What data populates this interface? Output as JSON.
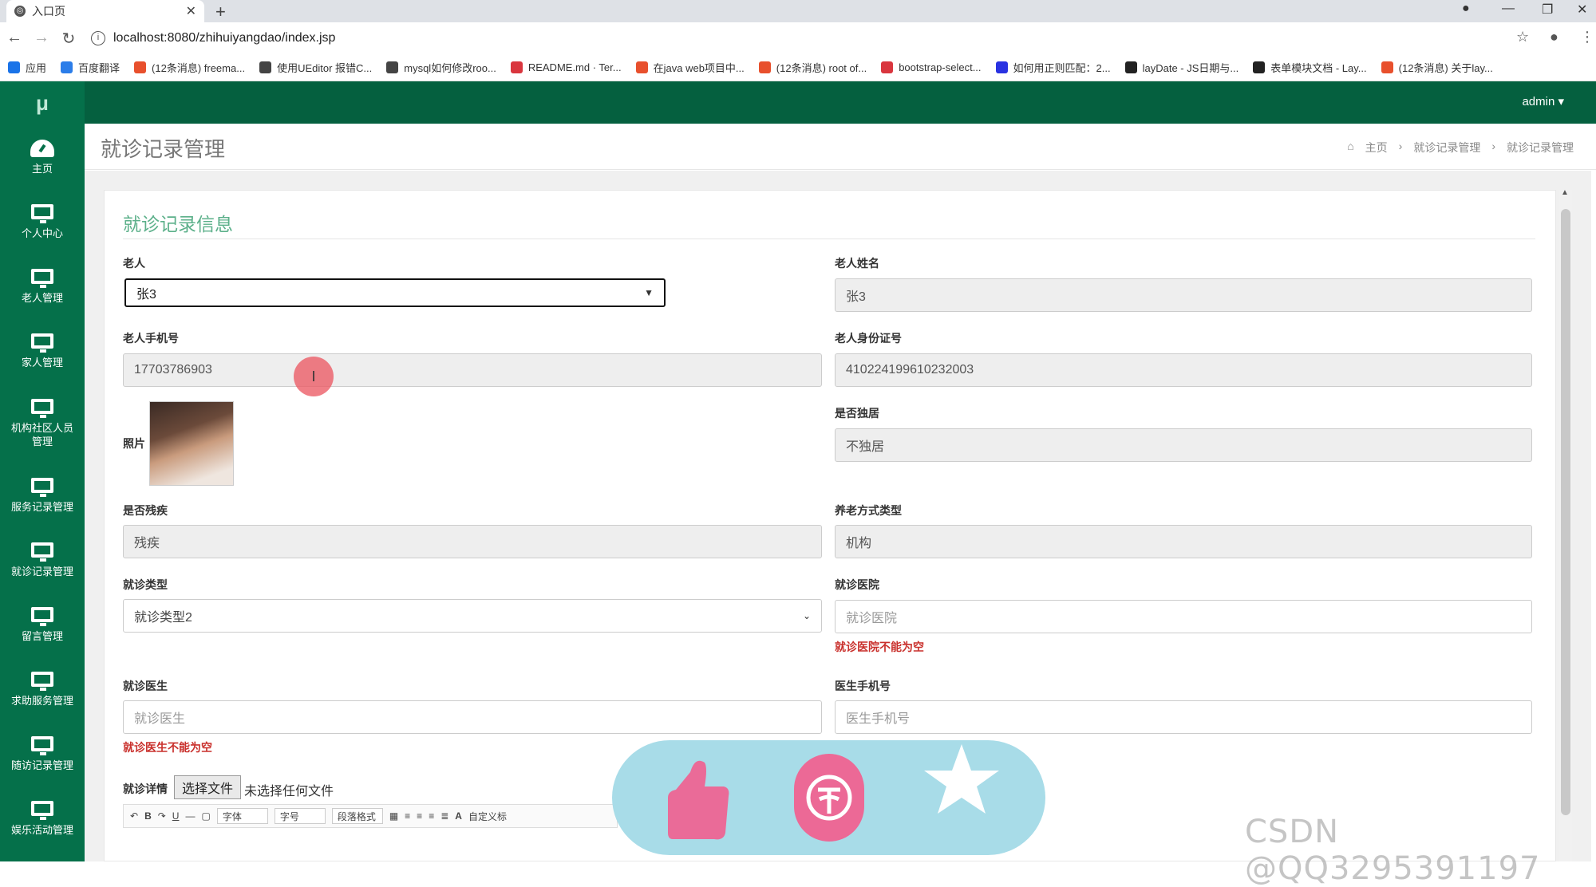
{
  "browser": {
    "tab_title": "入口页",
    "url": "localhost:8080/zhihuiyangdao/index.jsp",
    "bookmarks": [
      {
        "label": "应用",
        "color": "#1a73e8"
      },
      {
        "label": "百度翻译",
        "color": "#2b7de9"
      },
      {
        "label": "(12条消息) freema...",
        "color": "#e8502d"
      },
      {
        "label": "使用UEditor 报错C...",
        "color": "#444444"
      },
      {
        "label": "mysql如何修改roo...",
        "color": "#444444"
      },
      {
        "label": "README.md · Ter...",
        "color": "#d9363e"
      },
      {
        "label": "在java web项目中...",
        "color": "#e8502d"
      },
      {
        "label": "(12条消息) root of...",
        "color": "#e8502d"
      },
      {
        "label": "bootstrap-select...",
        "color": "#d9363e"
      },
      {
        "label": "如何用正则匹配：2...",
        "color": "#2932e1"
      },
      {
        "label": "layDate - JS日期与...",
        "color": "#222222"
      },
      {
        "label": "表单模块文档 - Lay...",
        "color": "#222222"
      },
      {
        "label": "(12条消息) 关于lay...",
        "color": "#e8502d"
      }
    ]
  },
  "sidebar": {
    "logo": "μ",
    "items": [
      {
        "label": "主页",
        "icon": "dashboard-icon"
      },
      {
        "label": "个人中心",
        "icon": "monitor-icon"
      },
      {
        "label": "老人管理",
        "icon": "monitor-icon"
      },
      {
        "label": "家人管理",
        "icon": "monitor-icon"
      },
      {
        "label": "机构社区人员管理",
        "icon": "monitor-icon"
      },
      {
        "label": "服务记录管理",
        "icon": "monitor-icon"
      },
      {
        "label": "就诊记录管理",
        "icon": "monitor-icon"
      },
      {
        "label": "留言管理",
        "icon": "monitor-icon"
      },
      {
        "label": "求助服务管理",
        "icon": "monitor-icon"
      },
      {
        "label": "随访记录管理",
        "icon": "monitor-icon"
      },
      {
        "label": "娱乐活动管理",
        "icon": "monitor-icon"
      }
    ]
  },
  "topbar": {
    "user": "admin ▾"
  },
  "page": {
    "title": "就诊记录管理",
    "breadcrumb": [
      "主页",
      "就诊记录管理",
      "就诊记录管理"
    ]
  },
  "form": {
    "section_title": "就诊记录信息",
    "elder_label": "老人",
    "elder_value": "张3",
    "elder_name_label": "老人姓名",
    "elder_name_value": "张3",
    "phone_label": "老人手机号",
    "phone_value": "17703786903",
    "idcard_label": "老人身份证号",
    "idcard_value": "410224199610232003",
    "photo_label": "照片",
    "alone_label": "是否独居",
    "alone_value": "不独居",
    "disabled_label": "是否残疾",
    "disabled_value": "残疾",
    "care_label": "养老方式类型",
    "care_value": "机构",
    "visit_type_label": "就诊类型",
    "visit_type_value": "就诊类型2",
    "hospital_label": "就诊医院",
    "hospital_placeholder": "就诊医院",
    "hospital_error": "就诊医院不能为空",
    "doctor_label": "就诊医生",
    "doctor_placeholder": "就诊医生",
    "doctor_error": "就诊医生不能为空",
    "doctor_phone_label": "医生手机号",
    "doctor_phone_placeholder": "医生手机号",
    "detail_label": "就诊详情",
    "file_button": "选择文件",
    "file_status": "未选择任何文件",
    "editor": {
      "font": "字体",
      "size": "字号",
      "para": "段落格式",
      "custom": "自定义标"
    }
  },
  "watermark": "CSDN @QQ3295391197",
  "colors": {
    "sidebar": "#05704a",
    "topbar": "#05603f",
    "accent": "#5cb08a",
    "error": "#c9302c"
  }
}
